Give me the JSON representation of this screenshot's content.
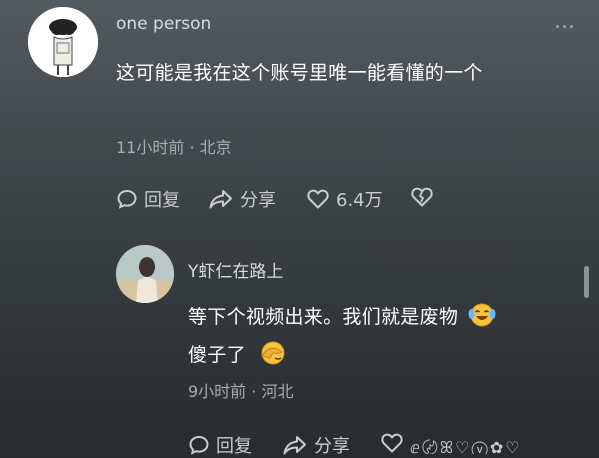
{
  "comment": {
    "username": "one person",
    "text": "这可能是我在这个账号里唯一能看懂的一个",
    "meta": "11小时前 · 北京",
    "actions": {
      "reply": "回复",
      "share": "分享",
      "likes": "6.4万"
    }
  },
  "reply": {
    "username": "Y虾仁在路上",
    "text_line1": "等下个视频出来。我们就是废物",
    "text_line2": "傻子了",
    "meta": "9小时前 · 河北",
    "actions": {
      "reply": "回复",
      "share": "分享"
    }
  },
  "icons": [
    "more-icon",
    "reply-icon",
    "share-icon",
    "heart-icon",
    "broken-heart-icon",
    "laughing-crying-emoji-icon",
    "facepalm-emoji-icon"
  ]
}
